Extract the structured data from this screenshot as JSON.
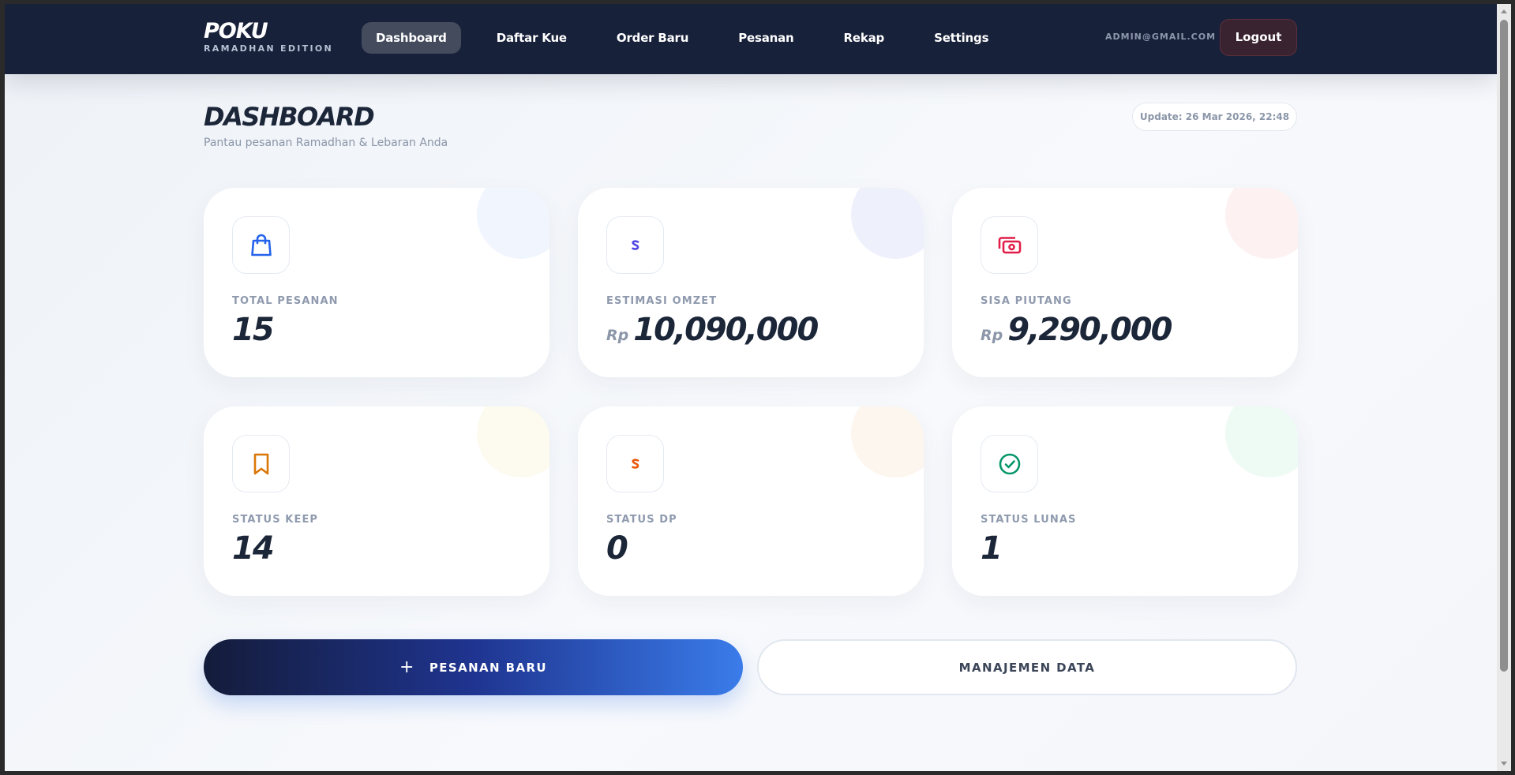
{
  "brand": {
    "name": "POKU",
    "subtitle": "RAMADHAN EDITION"
  },
  "nav": {
    "items": [
      {
        "label": "Dashboard",
        "active": true
      },
      {
        "label": "Daftar Kue",
        "active": false
      },
      {
        "label": "Order Baru",
        "active": false
      },
      {
        "label": "Pesanan",
        "active": false
      },
      {
        "label": "Rekap",
        "active": false
      },
      {
        "label": "Settings",
        "active": false
      }
    ],
    "user_email": "ADMIN@GMAIL.COM",
    "logout_label": "Logout"
  },
  "header": {
    "title": "DASHBOARD",
    "subtitle": "Pantau pesanan Ramadhan & Lebaran Anda",
    "update": "Update: 26 Mar 2026, 22:48"
  },
  "cards": [
    {
      "label": "TOTAL PESANAN",
      "value": "15",
      "currency": "",
      "icon": "shopping-bag-icon",
      "icon_color": "#2563eb",
      "blob_color": "#f1f5fd"
    },
    {
      "label": "ESTIMASI OMZET",
      "value": "10,090,000",
      "currency": "Rp",
      "icon": "dollar-icon",
      "icon_color": "#4f46e5",
      "blob_color": "#eef0fb"
    },
    {
      "label": "SISA PIUTANG",
      "value": "9,290,000",
      "currency": "Rp",
      "icon": "money-icon",
      "icon_color": "#e11d48",
      "blob_color": "#fdf1f2"
    },
    {
      "label": "STATUS KEEP",
      "value": "14",
      "currency": "",
      "icon": "bookmark-icon",
      "icon_color": "#d97706",
      "blob_color": "#fdfbf0"
    },
    {
      "label": "STATUS DP",
      "value": "0",
      "currency": "",
      "icon": "dollar-icon",
      "icon_color": "#ea580c",
      "blob_color": "#fdf6ef"
    },
    {
      "label": "STATUS LUNAS",
      "value": "1",
      "currency": "",
      "icon": "check-circle-icon",
      "icon_color": "#059669",
      "blob_color": "#eefbf5"
    }
  ],
  "actions": {
    "primary_label": "PESANAN BARU",
    "secondary_label": "MANAJEMEN DATA"
  }
}
